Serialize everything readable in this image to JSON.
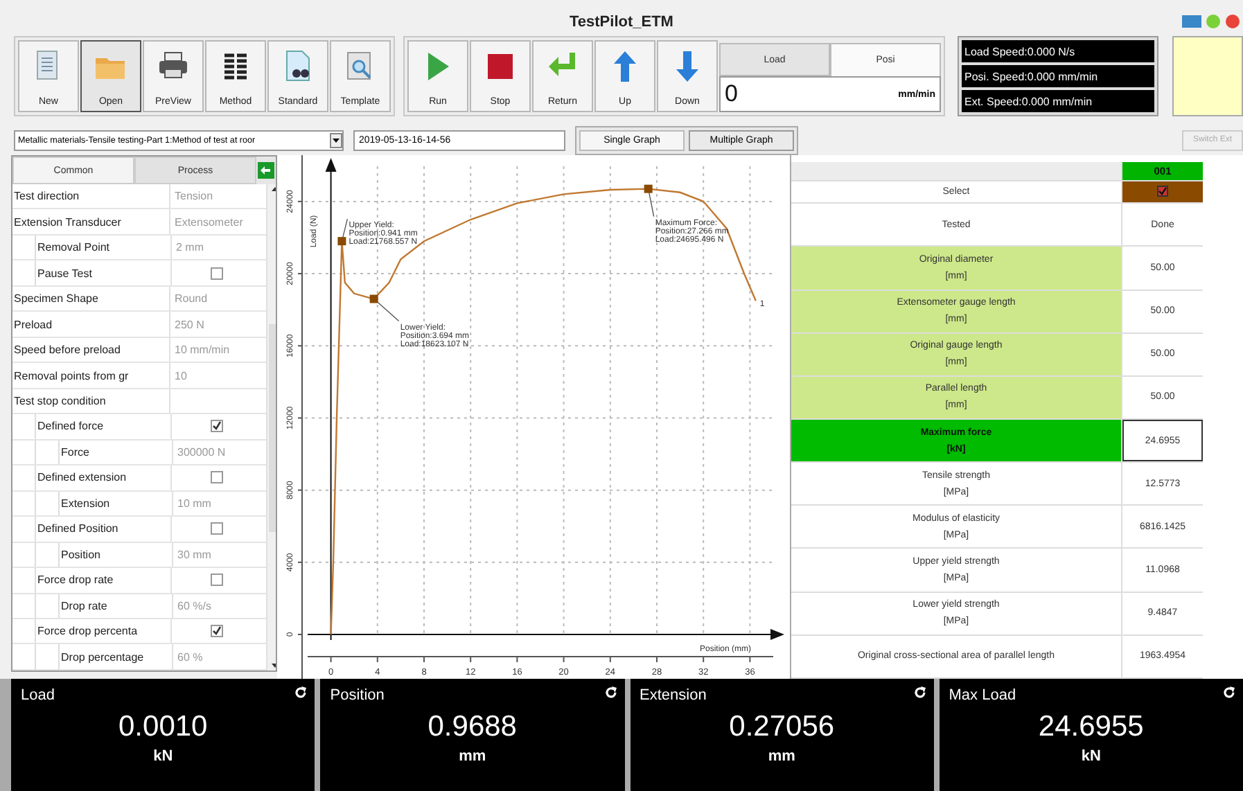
{
  "window": {
    "title": "TestPilot_ETM"
  },
  "toolbar": {
    "file_buttons": [
      {
        "label": "New",
        "selected": false
      },
      {
        "label": "Open",
        "selected": true
      },
      {
        "label": "PreView",
        "selected": false
      },
      {
        "label": "Method",
        "selected": false
      },
      {
        "label": "Standard",
        "selected": false
      },
      {
        "label": "Template",
        "selected": false
      }
    ],
    "control_buttons": [
      "Run",
      "Stop",
      "Return",
      "Up",
      "Down"
    ],
    "speed_tabs": [
      {
        "label": "Load",
        "selected": false
      },
      {
        "label": "Posi",
        "selected": true
      }
    ],
    "speed_field": {
      "value": "0",
      "unit": "mm/min"
    },
    "speed_readouts": [
      "Load Speed:0.000 N/s",
      "Posi. Speed:0.000 mm/min",
      "Ext. Speed:0.000 mm/min"
    ]
  },
  "method_dropdown": {
    "value": "Metallic materials-Tensile testing-Part 1:Method of test at roor"
  },
  "test_name_field": {
    "value": "2019-05-13-16-14-56"
  },
  "graph_tabs": [
    {
      "label": "Single Graph",
      "selected": true
    },
    {
      "label": "Multiple Graph",
      "selected": false
    }
  ],
  "switch_button": {
    "label": "Switch Ext",
    "disabled": true
  },
  "properties": {
    "tabs": [
      {
        "label": "Common",
        "selected": true
      },
      {
        "label": "Process",
        "selected": false
      }
    ],
    "items": [
      {
        "label": "Test direction",
        "kind": "text",
        "value": "Tension"
      },
      {
        "label": "Extension Transducer",
        "kind": "text",
        "value": "Extensometer",
        "children": [
          {
            "label": "Removal Point",
            "kind": "text",
            "value": "2 mm"
          },
          {
            "label": "Pause Test",
            "kind": "check",
            "checked": false
          }
        ]
      },
      {
        "label": "Specimen Shape",
        "kind": "text",
        "value": "Round"
      },
      {
        "label": "Preload",
        "kind": "text",
        "value": "250 N"
      },
      {
        "label": "Speed before preload",
        "kind": "text",
        "value": "10 mm/min"
      },
      {
        "label": "Removal points from gr",
        "kind": "text",
        "value": "10"
      },
      {
        "label": "Test stop condition",
        "kind": "group",
        "children": [
          {
            "label": "Defined force",
            "kind": "check",
            "checked": true,
            "children": [
              {
                "label": "Force",
                "kind": "text",
                "value": "300000 N"
              }
            ]
          },
          {
            "label": "Defined extension",
            "kind": "check",
            "checked": false,
            "children": [
              {
                "label": "Extension",
                "kind": "text",
                "value": "10 mm"
              }
            ]
          },
          {
            "label": "Defined Position",
            "kind": "check",
            "checked": false,
            "children": [
              {
                "label": "Position",
                "kind": "text",
                "value": "30 mm"
              }
            ]
          },
          {
            "label": "Force drop rate",
            "kind": "check",
            "checked": false,
            "children": [
              {
                "label": "Drop rate",
                "kind": "text",
                "value": "60 %/s"
              }
            ]
          },
          {
            "label": "Force drop percenta",
            "kind": "check",
            "checked": true,
            "children": [
              {
                "label": "Drop percentage",
                "kind": "text",
                "value": "60 %"
              }
            ]
          }
        ]
      }
    ]
  },
  "chart": {
    "chart_data": {
      "type": "line",
      "xlabel": "Position (mm)",
      "ylabel": "Load (N)",
      "x": [
        0,
        0.2,
        0.5,
        0.941,
        1.2,
        2,
        3.694,
        5,
        6,
        8,
        12,
        16,
        20,
        24,
        27.266,
        30,
        32,
        34,
        35.5,
        36.5
      ],
      "series": [
        {
          "name": "1",
          "color": "#c07830",
          "values": [
            0,
            4000,
            12000,
            21800,
            19500,
            18900,
            18600,
            19500,
            20800,
            21800,
            23000,
            23900,
            24400,
            24650,
            24700,
            24500,
            24000,
            22500,
            20000,
            18500
          ]
        }
      ],
      "xlim": [
        -2,
        38
      ],
      "grid": true,
      "ylim": [
        0,
        25800
      ],
      "xticks": [
        0,
        4,
        8,
        12,
        16,
        20,
        24,
        28,
        32,
        36
      ],
      "yticks": [
        0,
        4000,
        8000,
        12000,
        16000,
        20000,
        24000
      ],
      "annotations": [
        {
          "x": 0.941,
          "y": 21800,
          "text": "Upper Yield:\nPosition:0.941 mm\nLoad:21768.557 N"
        },
        {
          "x": 3.694,
          "y": 18600,
          "text": "Lower Yield:\nPosition:3.694 mm\nLoad:18623.107 N"
        },
        {
          "x": 27.266,
          "y": 24700,
          "text": "Maximum Force:\nPosition:27.266 mm\nLoad:24695.496 N"
        }
      ]
    }
  },
  "results": {
    "specimen": "001",
    "select": {
      "label": "Select",
      "checked": true
    },
    "rows": [
      {
        "label": "Tested",
        "kind": "status",
        "selected": false,
        "value": "Done"
      },
      {
        "label": "Original diameter",
        "unit": "[mm]",
        "kind": "input",
        "selected": false,
        "value": "50.00"
      },
      {
        "label": "Extensometer gauge length",
        "unit": "[mm]",
        "kind": "input",
        "selected": false,
        "value": "50.00"
      },
      {
        "label": "Original gauge length",
        "unit": "[mm]",
        "kind": "input",
        "selected": false,
        "value": "50.00"
      },
      {
        "label": "Parallel length",
        "unit": "[mm]",
        "kind": "input",
        "selected": false,
        "value": "50.00"
      },
      {
        "label": "Maximum force",
        "unit": "[kN]",
        "kind": "result",
        "selected": true,
        "value": "24.6955"
      },
      {
        "label": "Tensile strength",
        "unit": "[MPa]",
        "kind": "result",
        "selected": false,
        "value": "12.5773"
      },
      {
        "label": "Modulus of elasticity",
        "unit": "[MPa]",
        "kind": "result",
        "selected": false,
        "value": "6816.1425"
      },
      {
        "label": "Upper yield strength",
        "unit": "[MPa]",
        "kind": "result",
        "selected": false,
        "value": "11.0968"
      },
      {
        "label": "Lower yield strength",
        "unit": "[MPa]",
        "kind": "result",
        "selected": false,
        "value": "9.4847"
      },
      {
        "label": "Original cross-sectional area of parallel length",
        "kind": "result",
        "selected": false,
        "value": "1963.4954"
      }
    ]
  },
  "readouts": [
    {
      "label": "Load",
      "value": "0.0010",
      "unit": "kN"
    },
    {
      "label": "Position",
      "value": "0.9688",
      "unit": "mm"
    },
    {
      "label": "Extension",
      "value": "0.27056",
      "unit": "mm"
    },
    {
      "label": "Max Load",
      "value": "24.6955",
      "unit": "kN"
    }
  ]
}
